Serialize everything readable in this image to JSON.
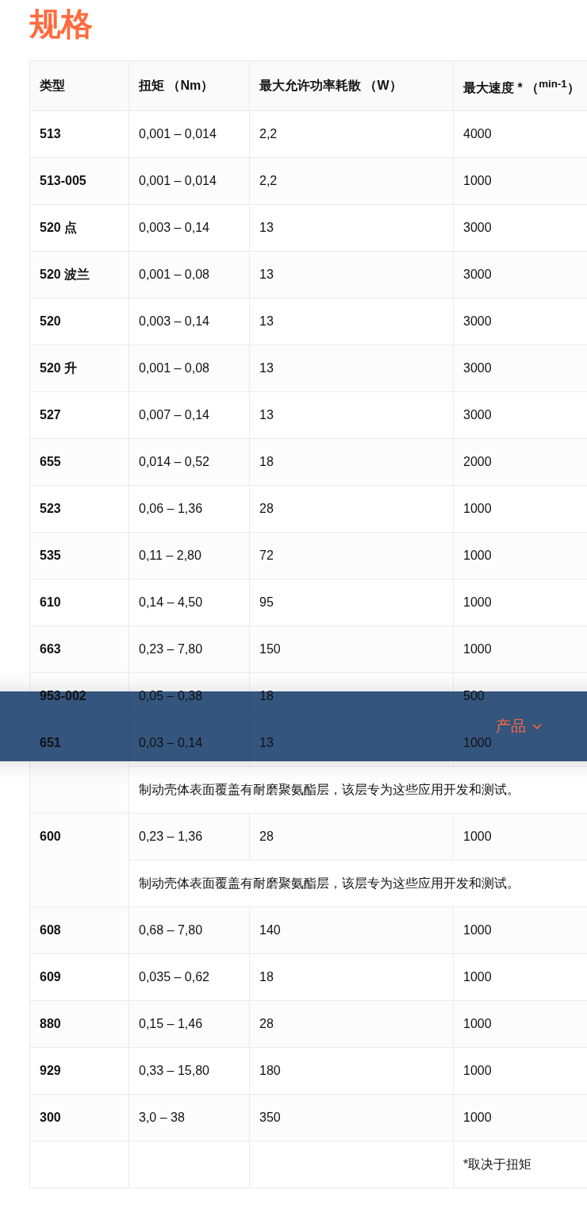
{
  "title": "规格",
  "table": {
    "columns": [
      "类型",
      "扭矩 （Nm）",
      "最大允许功率耗散 （W）",
      "最大速度 * （$^{min-1}$）"
    ],
    "rows": [
      {
        "type": "513",
        "torque": "0,001 – 0,014",
        "power": "2,2",
        "speed": "4000"
      },
      {
        "type": "513-005",
        "torque": "0,001 – 0,014",
        "power": "2,2",
        "speed": "1000"
      },
      {
        "type": "520 点",
        "torque": "0,003 – 0,14",
        "power": "13",
        "speed": "3000"
      },
      {
        "type": "520 波兰",
        "torque": "0,001 – 0,08",
        "power": "13",
        "speed": "3000"
      },
      {
        "type": "520",
        "torque": "0,003 – 0,14",
        "power": "13",
        "speed": "3000"
      },
      {
        "type": "520 升",
        "torque": "0,001 – 0,08",
        "power": "13",
        "speed": "3000"
      },
      {
        "type": "527",
        "torque": "0,007 – 0,14",
        "power": "13",
        "speed": "3000"
      },
      {
        "type": "655",
        "torque": "0,014 – 0,52",
        "power": "18",
        "speed": "2000"
      },
      {
        "type": "523",
        "torque": "0,06 – 1,36",
        "power": "28",
        "speed": "1000"
      },
      {
        "type": "535",
        "torque": "0,11 – 2,80",
        "power": "72",
        "speed": "1000"
      },
      {
        "type": "610",
        "torque": "0,14 – 4,50",
        "power": "95",
        "speed": "1000"
      },
      {
        "type": "663",
        "torque": "0,23 – 7,80",
        "power": "150",
        "speed": "1000"
      },
      {
        "type": "953-002",
        "torque": "0,05 – 0,38",
        "power": "18",
        "speed": "500"
      },
      {
        "type": "651",
        "torque": "0,03 – 0,14",
        "power": "13",
        "speed": "1000",
        "note": "制动壳体表面覆盖有耐磨聚氨酯层，该层专为这些应用开发和测试。"
      },
      {
        "type": "600",
        "torque": "0,23 – 1,36",
        "power": "28",
        "speed": "1000",
        "note": "制动壳体表面覆盖有耐磨聚氨酯层，该层专为这些应用开发和测试。"
      },
      {
        "type": "608",
        "torque": "0,68 – 7,80",
        "power": "140",
        "speed": "1000"
      },
      {
        "type": "609",
        "torque": "0,035 – 0,62",
        "power": "18",
        "speed": "1000"
      },
      {
        "type": "880",
        "torque": "0,15 – 1,46",
        "power": "28",
        "speed": "1000"
      },
      {
        "type": "929",
        "torque": "0,33 – 15,80",
        "power": "180",
        "speed": "1000"
      },
      {
        "type": "300",
        "torque": "3,0 – 38",
        "power": "350",
        "speed": "1000"
      }
    ],
    "footnote": "*取决于扭矩"
  },
  "nav": {
    "items": [
      {
        "label": "产品",
        "selected": true
      }
    ]
  }
}
